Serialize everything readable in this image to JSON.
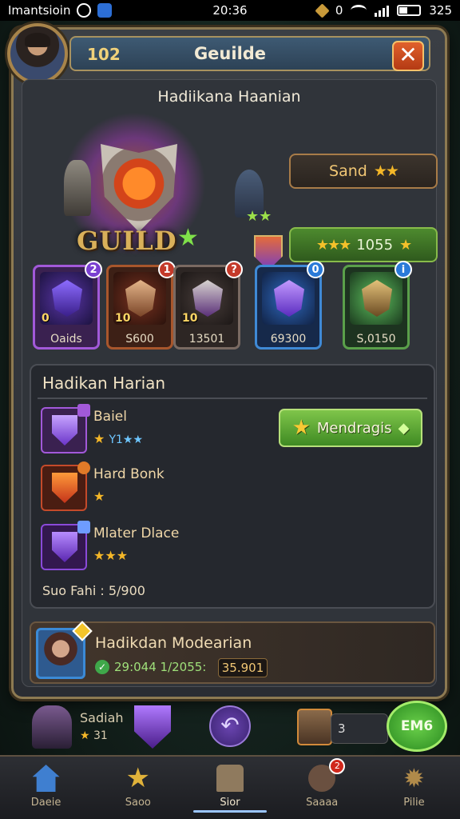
{
  "status_bar": {
    "carrier": "Imantsioin",
    "time": "20:36",
    "right_value": "0",
    "battery": "325"
  },
  "window": {
    "level": "102",
    "title": "Geuilde",
    "close_symbol": "✕",
    "subtitle": "Hadiikana Haanian"
  },
  "emblem": {
    "label": "GUILD",
    "star": "★"
  },
  "rank_box": {
    "label": "Sand",
    "stars": "★★"
  },
  "score_box": {
    "stars": "★★★",
    "value": "1055",
    "trailing_star": "★"
  },
  "cards": [
    {
      "badge": "2",
      "level": "0",
      "caption": "Oaids",
      "color": "#a259d9"
    },
    {
      "badge": "1",
      "level": "10",
      "caption": "S600",
      "color": "#a8562c"
    },
    {
      "badge": "?",
      "level": "10",
      "caption": "13501",
      "color": "#7a6a62"
    },
    {
      "badge": "0",
      "level": "",
      "caption": "69300",
      "color": "#3f8ad6"
    },
    {
      "badge": "i",
      "level": "",
      "caption": "S,0150",
      "color": "#5aa04a"
    }
  ],
  "quests": {
    "header": "Hadikan Harian",
    "items": [
      {
        "name": "Baiel",
        "stars": "★",
        "extra": "Y1★★"
      },
      {
        "name": "Hard Bonk",
        "stars": "★",
        "extra": ""
      },
      {
        "name": "Mlater Dlace",
        "stars": "★★★",
        "extra": ""
      }
    ],
    "claim_label": "Mendragis",
    "total_label": "Suo Fahi : 5/900"
  },
  "member": {
    "name": "Hadikdan Modearian",
    "stat": "29:044 1/2055:",
    "score": "35.901"
  },
  "hud": {
    "name": "Sadiah",
    "level": "31",
    "back_symbol": "↶",
    "slot_value": "3",
    "go_label": "EM6"
  },
  "nav": [
    {
      "label": "Daeie",
      "icon": "home-icon",
      "active": false
    },
    {
      "label": "Saoo",
      "icon": "star-icon",
      "active": false
    },
    {
      "label": "Sior",
      "icon": "shop-icon",
      "active": true
    },
    {
      "label": "Saaaa",
      "icon": "bag-icon",
      "active": false,
      "badge": "2"
    },
    {
      "label": "Pilie",
      "icon": "gear-icon",
      "active": false
    }
  ]
}
